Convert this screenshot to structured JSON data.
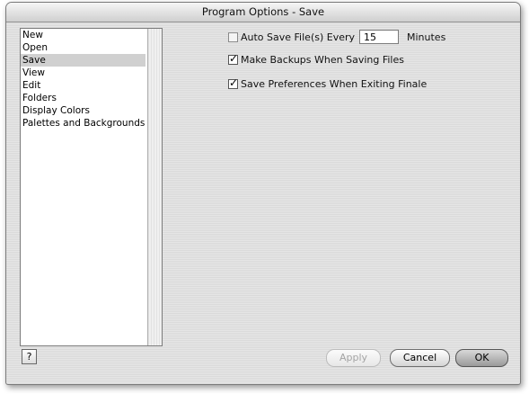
{
  "window": {
    "title": "Program Options - Save"
  },
  "categories": {
    "items": [
      {
        "label": "New"
      },
      {
        "label": "Open"
      },
      {
        "label": "Save"
      },
      {
        "label": "View"
      },
      {
        "label": "Edit"
      },
      {
        "label": "Folders"
      },
      {
        "label": "Display Colors"
      },
      {
        "label": "Palettes and Backgrounds"
      }
    ],
    "selected": "Save"
  },
  "options": {
    "auto_save": {
      "label": "Auto Save File(s) Every",
      "checked": false,
      "value": "15",
      "unit": "Minutes"
    },
    "make_backups": {
      "label": "Make Backups When Saving Files",
      "checked": true
    },
    "save_prefs": {
      "label": "Save Preferences When Exiting Finale",
      "checked": true
    }
  },
  "buttons": {
    "help": "?",
    "apply": "Apply",
    "cancel": "Cancel",
    "ok": "OK"
  }
}
